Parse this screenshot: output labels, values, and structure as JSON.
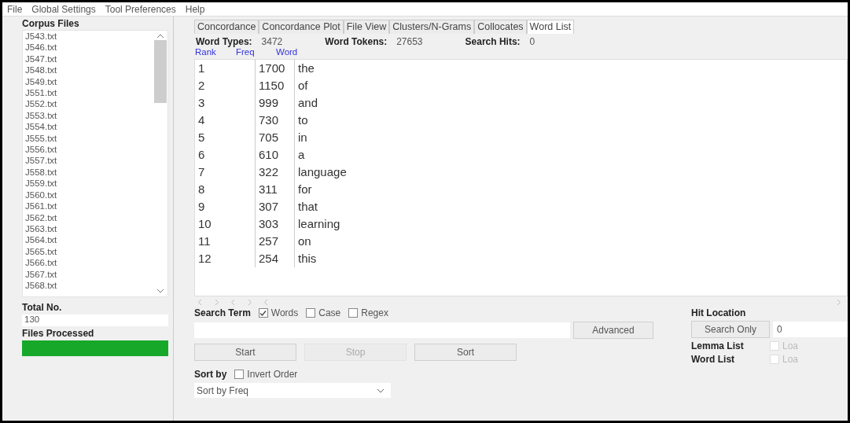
{
  "menu": [
    "File",
    "Global Settings",
    "Tool Preferences",
    "Help"
  ],
  "sidebar": {
    "title": "Corpus Files",
    "files": [
      "J543.txt",
      "J546.txt",
      "J547.txt",
      "J548.txt",
      "J549.txt",
      "J551.txt",
      "J552.txt",
      "J553.txt",
      "J554.txt",
      "J555.txt",
      "J556.txt",
      "J557.txt",
      "J558.txt",
      "J559.txt",
      "J560.txt",
      "J561.txt",
      "J562.txt",
      "J563.txt",
      "J564.txt",
      "J565.txt",
      "J566.txt",
      "J567.txt",
      "J568.txt"
    ],
    "total_label": "Total No.",
    "total_value": "130",
    "processed_label": "Files Processed",
    "progress": {
      "level": 1
    }
  },
  "tabs": [
    {
      "label": "Concordance",
      "selected": false
    },
    {
      "label": "Concordance Plot",
      "selected": false
    },
    {
      "label": "File View",
      "selected": false
    },
    {
      "label": "Clusters/N-Grams",
      "selected": false
    },
    {
      "label": "Collocates",
      "selected": false
    },
    {
      "label": "Word List",
      "selected": true
    }
  ],
  "stats": [
    {
      "label": "Word Types:",
      "value": "3472"
    },
    {
      "label": "Word Tokens:",
      "value": "27653"
    },
    {
      "label": "Search Hits:",
      "value": "0"
    }
  ],
  "table": {
    "columns": [
      "Rank",
      "Freq",
      "Word"
    ],
    "rows": [
      [
        "1",
        "1700",
        "the"
      ],
      [
        "2",
        "1150",
        "of"
      ],
      [
        "3",
        "999",
        "and"
      ],
      [
        "4",
        "730",
        "to"
      ],
      [
        "5",
        "705",
        "in"
      ],
      [
        "6",
        "610",
        "a"
      ],
      [
        "7",
        "322",
        "language"
      ],
      [
        "8",
        "311",
        "for"
      ],
      [
        "9",
        "307",
        "that"
      ],
      [
        "10",
        "303",
        "learning"
      ],
      [
        "11",
        "257",
        "on"
      ],
      [
        "12",
        "254",
        "this"
      ]
    ]
  },
  "search": {
    "label": "Search Term",
    "options": [
      {
        "label": "Words",
        "checked": true
      },
      {
        "label": "Case",
        "checked": false
      },
      {
        "label": "Regex",
        "checked": false
      }
    ],
    "advanced_button": "Advanced"
  },
  "buttons": [
    {
      "label": "Start",
      "disabled": false
    },
    {
      "label": "Stop",
      "disabled": true
    },
    {
      "label": "Sort",
      "disabled": false
    }
  ],
  "sort": {
    "label": "Sort by",
    "invert": {
      "label": "Invert Order",
      "checked": false
    },
    "dropdown": "Sort by Freq"
  },
  "hit_location": {
    "label": "Hit Location",
    "button": "Search Only",
    "value": "0"
  },
  "lists": [
    {
      "label": "Lemma List",
      "option": "Loa",
      "disabled": true
    },
    {
      "label": "Word List",
      "option": "Loa",
      "disabled": true
    }
  ]
}
